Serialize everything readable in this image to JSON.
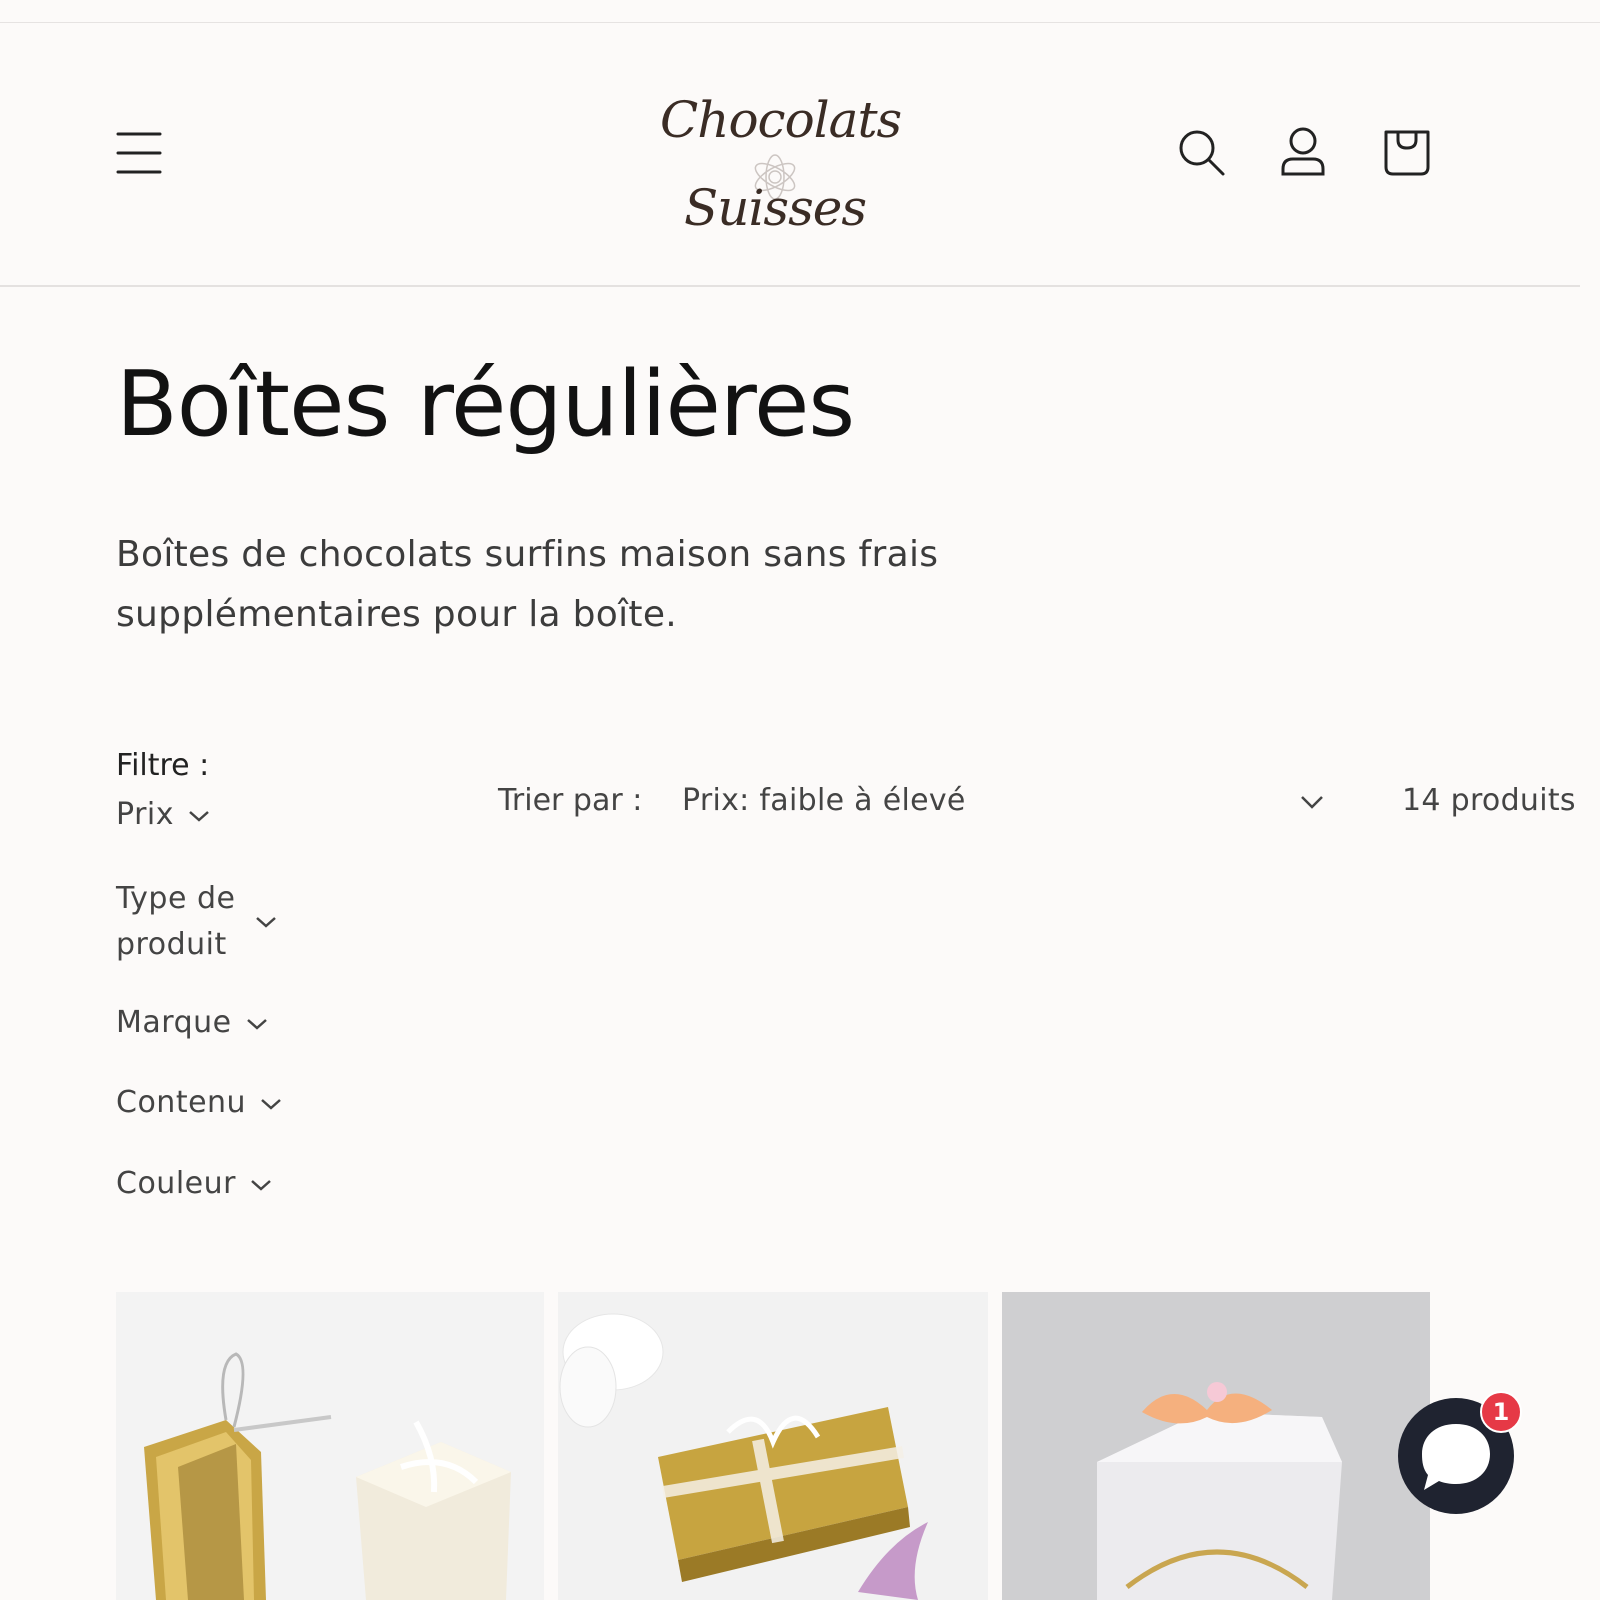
{
  "header": {
    "menu_icon": "hamburger-menu-icon",
    "logo": {
      "line1": "Chocolats",
      "line2": "Suisses"
    },
    "search_icon": "search-icon",
    "account_icon": "user-icon",
    "cart_icon": "shopping-bag-icon"
  },
  "collection": {
    "title": "Boîtes régulières",
    "description": "Boîtes de chocolats surfins maison sans frais supplémentaires pour la boîte."
  },
  "filters": {
    "label": "Filtre :",
    "facets": [
      {
        "label": "Prix"
      },
      {
        "label": "Type de produit"
      },
      {
        "label": "Marque"
      },
      {
        "label": "Contenu"
      },
      {
        "label": "Couleur"
      }
    ]
  },
  "sort": {
    "label": "Trier par :",
    "selected": "Prix: faible à élevé"
  },
  "results": {
    "count": "14 produits"
  },
  "products": [
    {
      "image": "gold and white gift boxes with ribbons"
    },
    {
      "image": "gold foil chocolate box with white bow and flowers"
    },
    {
      "image": "white box with peach ribbon and gold logo"
    }
  ],
  "chat": {
    "badge": "1",
    "icon": "chat-bubble-icon"
  },
  "colors": {
    "background": "#fcfaf9",
    "text": "#1a1a1a",
    "chat": "#1f2330",
    "badge": "#e63946"
  }
}
